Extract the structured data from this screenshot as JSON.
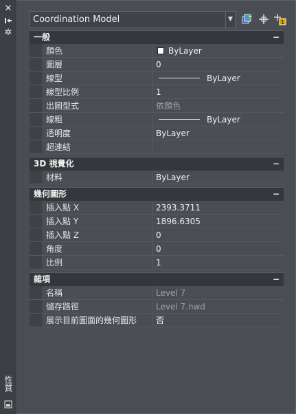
{
  "toolbar": {
    "dropdown_value": "Coordination Model",
    "buttons": [
      "quick-select-icon",
      "select-objects-icon",
      "toggle-pickadd-icon"
    ]
  },
  "side_label": "性質",
  "categories": [
    {
      "title": "一般",
      "rows": [
        {
          "name": "顏色",
          "value": "ByLayer"
        },
        {
          "name": "圖層",
          "value": "0"
        },
        {
          "name": "線型",
          "value": "ByLayer"
        },
        {
          "name": "線型比例",
          "value": "1"
        },
        {
          "name": "出圖型式",
          "value": "依顏色"
        },
        {
          "name": "線粗",
          "value": "ByLayer"
        },
        {
          "name": "透明度",
          "value": "ByLayer"
        },
        {
          "name": "超連結",
          "value": ""
        }
      ]
    },
    {
      "title": "3D 視覺化",
      "rows": [
        {
          "name": "材料",
          "value": "ByLayer"
        }
      ]
    },
    {
      "title": "幾何圖形",
      "rows": [
        {
          "name": "插入點 X",
          "value": "2393.3711"
        },
        {
          "name": "插入點 Y",
          "value": "1896.6305"
        },
        {
          "name": "插入點 Z",
          "value": "0"
        },
        {
          "name": "角度",
          "value": "0"
        },
        {
          "name": "比例",
          "value": "1"
        }
      ]
    },
    {
      "title": "雜項",
      "rows": [
        {
          "name": "名稱",
          "value": "Level 7"
        },
        {
          "name": "儲存路徑",
          "value": "Level 7.nwd"
        },
        {
          "name": "展示目前圖面的幾何圖形",
          "value": "否"
        }
      ]
    }
  ],
  "collapse_symbol": "−"
}
